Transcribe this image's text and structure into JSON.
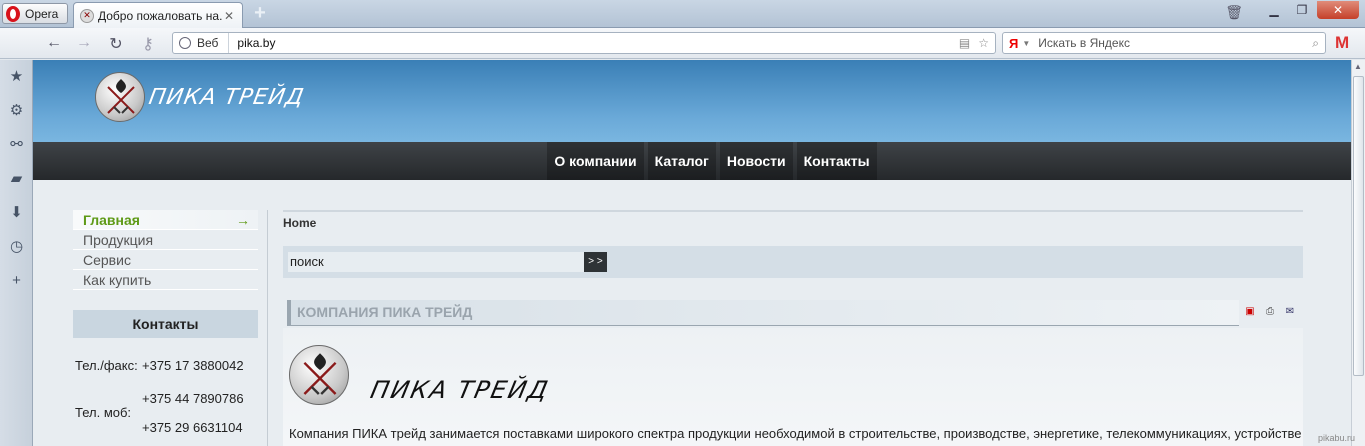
{
  "browser": {
    "menu_label": "Opera",
    "tab_title": "Добро пожаловать на...",
    "url_site_label": "Веб",
    "url": "pika.by",
    "search_placeholder": "Искать в Яндекс",
    "search_engine_glyph": "Я",
    "mail_glyph": "M"
  },
  "site": {
    "logo_text": "ПИКА ТРЕЙД",
    "nav": [
      "О компании",
      "Каталог",
      "Новости",
      "Контакты"
    ],
    "left_menu": [
      "Главная",
      "Продукция",
      "Сервис",
      "Как купить"
    ],
    "active_arrow": "→",
    "contacts": {
      "title": "Контакты",
      "phone_label": "Тел./факс:",
      "phone": "+375 17 3880042",
      "mobile_label": "Тел. моб:",
      "mobile_1": "+375 44 7890786",
      "mobile_2": "+375 29 6631104"
    },
    "breadcrumb": "Home",
    "search": {
      "value": "поиск",
      "button": "> >"
    },
    "article": {
      "title": "КОМПАНИЯ ПИКА ТРЕЙД",
      "logo_text": "ПИКА ТРЕЙД",
      "body": "Компания ПИКА трейд занимается поставками широкого спектра продукции необходимой в строительстве, производстве, энергетике, телекоммуникациях, устройстве"
    }
  },
  "watermark": "pikabu.ru",
  "colors": {
    "header_top": "#3a7fb6",
    "header_bottom": "#7ab6e0",
    "nav_bg": "#2b2e31",
    "active_menu": "#5e9a16"
  }
}
